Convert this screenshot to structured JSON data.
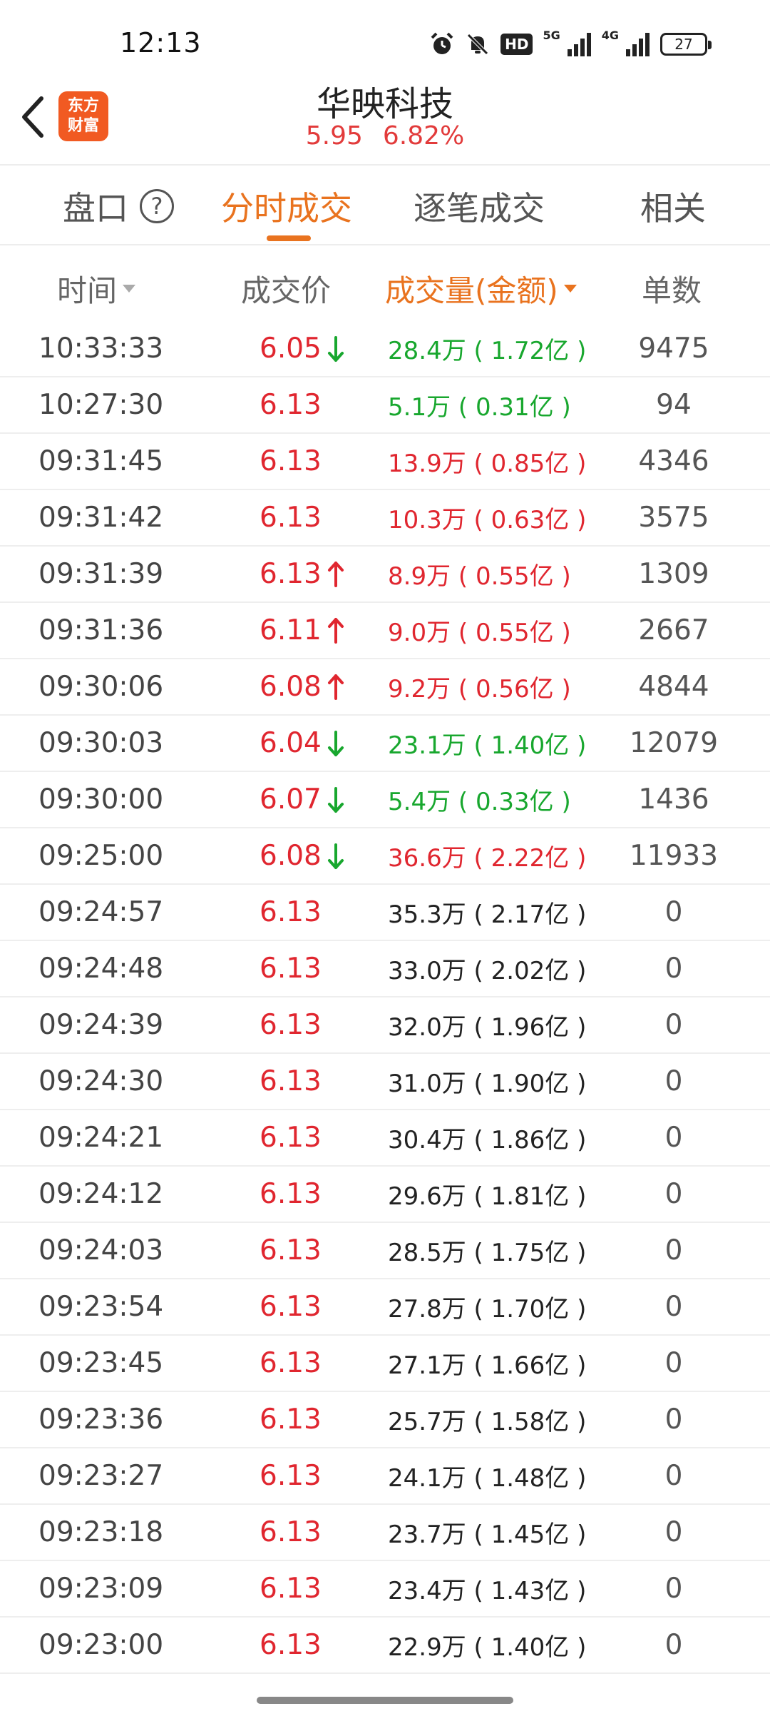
{
  "status_bar": {
    "time": "12:13",
    "hd_label": "HD",
    "net1_label": "5G",
    "net2_label": "4G",
    "battery": "27"
  },
  "header": {
    "logo_line1": "东方",
    "logo_line2": "财富",
    "title": "华映科技",
    "price": "5.95",
    "change_pct": "6.82%"
  },
  "tabs": [
    {
      "label": "盘口"
    },
    {
      "label": "分时成交"
    },
    {
      "label": "逐笔成交"
    },
    {
      "label": "相关"
    }
  ],
  "help_icon_glyph": "?",
  "columns": {
    "time": "时间",
    "price": "成交价",
    "volume": "成交量(金额)",
    "count": "单数"
  },
  "colors": {
    "up": "#e0262f",
    "down": "#18a72e",
    "accent": "#e9731f"
  },
  "rows": [
    {
      "time": "10:33:33",
      "price": "6.05",
      "arrow": "down",
      "volume": "28.4万 ( 1.72亿 )",
      "vol_color": "green",
      "count": "9475"
    },
    {
      "time": "10:27:30",
      "price": "6.13",
      "arrow": "",
      "volume": "5.1万 ( 0.31亿 )",
      "vol_color": "green",
      "count": "94"
    },
    {
      "time": "09:31:45",
      "price": "6.13",
      "arrow": "",
      "volume": "13.9万 ( 0.85亿 )",
      "vol_color": "red",
      "count": "4346"
    },
    {
      "time": "09:31:42",
      "price": "6.13",
      "arrow": "",
      "volume": "10.3万 ( 0.63亿 )",
      "vol_color": "red",
      "count": "3575"
    },
    {
      "time": "09:31:39",
      "price": "6.13",
      "arrow": "up",
      "volume": "8.9万 ( 0.55亿 )",
      "vol_color": "red",
      "count": "1309"
    },
    {
      "time": "09:31:36",
      "price": "6.11",
      "arrow": "up",
      "volume": "9.0万 ( 0.55亿 )",
      "vol_color": "red",
      "count": "2667"
    },
    {
      "time": "09:30:06",
      "price": "6.08",
      "arrow": "up",
      "volume": "9.2万 ( 0.56亿 )",
      "vol_color": "red",
      "count": "4844"
    },
    {
      "time": "09:30:03",
      "price": "6.04",
      "arrow": "down",
      "volume": "23.1万 ( 1.40亿 )",
      "vol_color": "green",
      "count": "12079"
    },
    {
      "time": "09:30:00",
      "price": "6.07",
      "arrow": "down",
      "volume": "5.4万 ( 0.33亿 )",
      "vol_color": "green",
      "count": "1436"
    },
    {
      "time": "09:25:00",
      "price": "6.08",
      "arrow": "down",
      "volume": "36.6万 ( 2.22亿 )",
      "vol_color": "red",
      "count": "11933"
    },
    {
      "time": "09:24:57",
      "price": "6.13",
      "arrow": "",
      "volume": "35.3万 ( 2.17亿 )",
      "vol_color": "dark",
      "count": "0"
    },
    {
      "time": "09:24:48",
      "price": "6.13",
      "arrow": "",
      "volume": "33.0万 ( 2.02亿 )",
      "vol_color": "dark",
      "count": "0"
    },
    {
      "time": "09:24:39",
      "price": "6.13",
      "arrow": "",
      "volume": "32.0万 ( 1.96亿 )",
      "vol_color": "dark",
      "count": "0"
    },
    {
      "time": "09:24:30",
      "price": "6.13",
      "arrow": "",
      "volume": "31.0万 ( 1.90亿 )",
      "vol_color": "dark",
      "count": "0"
    },
    {
      "time": "09:24:21",
      "price": "6.13",
      "arrow": "",
      "volume": "30.4万 ( 1.86亿 )",
      "vol_color": "dark",
      "count": "0"
    },
    {
      "time": "09:24:12",
      "price": "6.13",
      "arrow": "",
      "volume": "29.6万 ( 1.81亿 )",
      "vol_color": "dark",
      "count": "0"
    },
    {
      "time": "09:24:03",
      "price": "6.13",
      "arrow": "",
      "volume": "28.5万 ( 1.75亿 )",
      "vol_color": "dark",
      "count": "0"
    },
    {
      "time": "09:23:54",
      "price": "6.13",
      "arrow": "",
      "volume": "27.8万 ( 1.70亿 )",
      "vol_color": "dark",
      "count": "0"
    },
    {
      "time": "09:23:45",
      "price": "6.13",
      "arrow": "",
      "volume": "27.1万 ( 1.66亿 )",
      "vol_color": "dark",
      "count": "0"
    },
    {
      "time": "09:23:36",
      "price": "6.13",
      "arrow": "",
      "volume": "25.7万 ( 1.58亿 )",
      "vol_color": "dark",
      "count": "0"
    },
    {
      "time": "09:23:27",
      "price": "6.13",
      "arrow": "",
      "volume": "24.1万 ( 1.48亿 )",
      "vol_color": "dark",
      "count": "0"
    },
    {
      "time": "09:23:18",
      "price": "6.13",
      "arrow": "",
      "volume": "23.7万 ( 1.45亿 )",
      "vol_color": "dark",
      "count": "0"
    },
    {
      "time": "09:23:09",
      "price": "6.13",
      "arrow": "",
      "volume": "23.4万 ( 1.43亿 )",
      "vol_color": "dark",
      "count": "0"
    },
    {
      "time": "09:23:00",
      "price": "6.13",
      "arrow": "",
      "volume": "22.9万 ( 1.40亿 )",
      "vol_color": "dark",
      "count": "0"
    }
  ]
}
